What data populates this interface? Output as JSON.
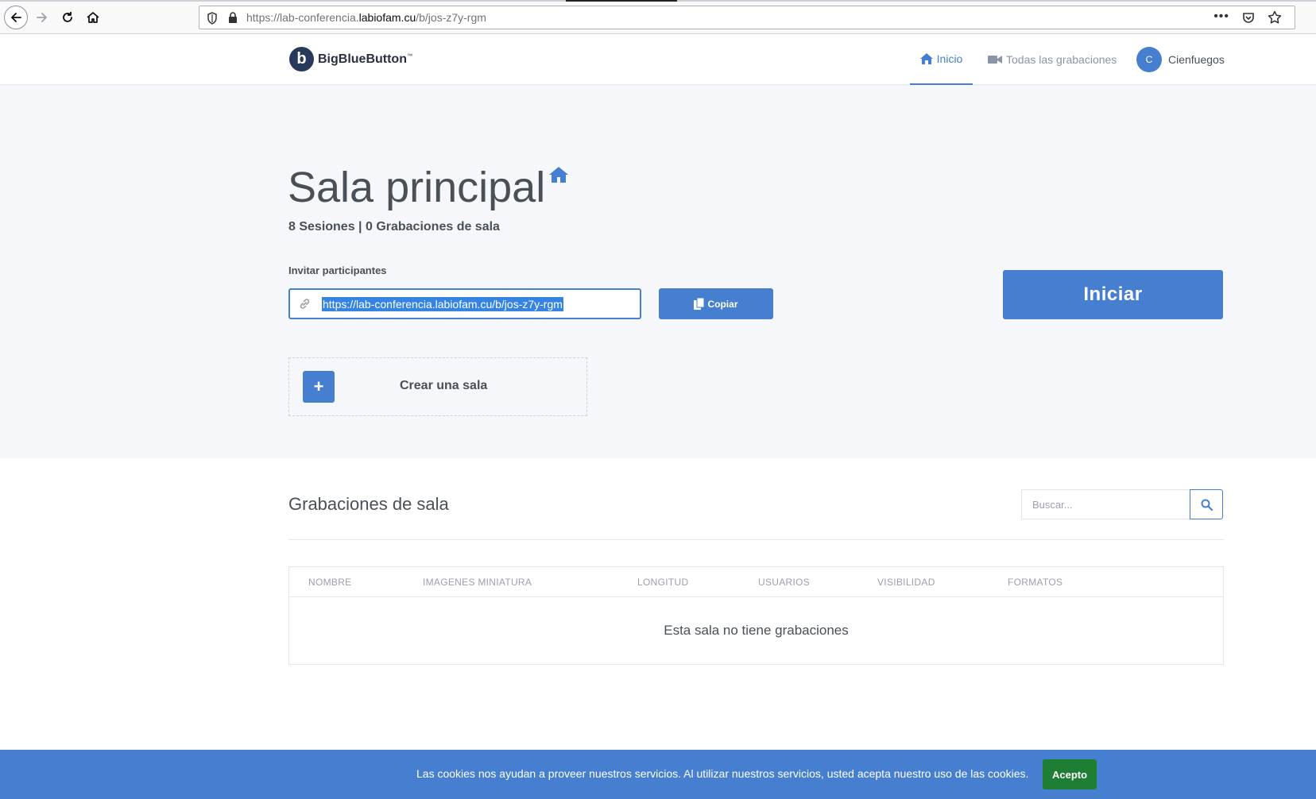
{
  "browser": {
    "url_prefix": "https://lab-conferencia.",
    "url_domain": "labiofam.cu",
    "url_path": "/b/jos-z7y-rgm",
    "more_label": "•••"
  },
  "header": {
    "logo_letter": "b",
    "logo_text": "BigBlueButton",
    "nav": {
      "inicio": "Inicio",
      "grabaciones": "Todas las grabaciones"
    },
    "user": {
      "initial": "C",
      "name": "Cienfuegos"
    }
  },
  "room": {
    "title": "Sala principal",
    "stats": "8 Sesiones | 0 Grabaciones de sala",
    "invite_label": "Invitar participantes",
    "invite_url": "https://lab-conferencia.labiofam.cu/b/jos-z7y-rgm",
    "copy_label": "Copiar",
    "start_label": "Iniciar",
    "create_plus": "+",
    "create_label": "Crear una sala"
  },
  "recordings": {
    "title": "Grabaciones de sala",
    "search_placeholder": "Buscar...",
    "columns": [
      "NOMBRE",
      "IMAGENES MINIATURA",
      "LONGITUD",
      "USUARIOS",
      "VISIBILIDAD",
      "FORMATOS"
    ],
    "empty_message": "Esta sala no tiene grabaciones"
  },
  "cookies": {
    "message": "Las cookies nos ayudan a proveer nuestros servicios. Al utilizar nuestros servicios, usted acepta nuestro uso de las cookies.",
    "accept_label": "Acepto"
  },
  "colors": {
    "accent": "#467fcf",
    "hero_bg": "#f5f7fb",
    "accept_green": "#1e7e34",
    "selection": "#3584e4"
  }
}
